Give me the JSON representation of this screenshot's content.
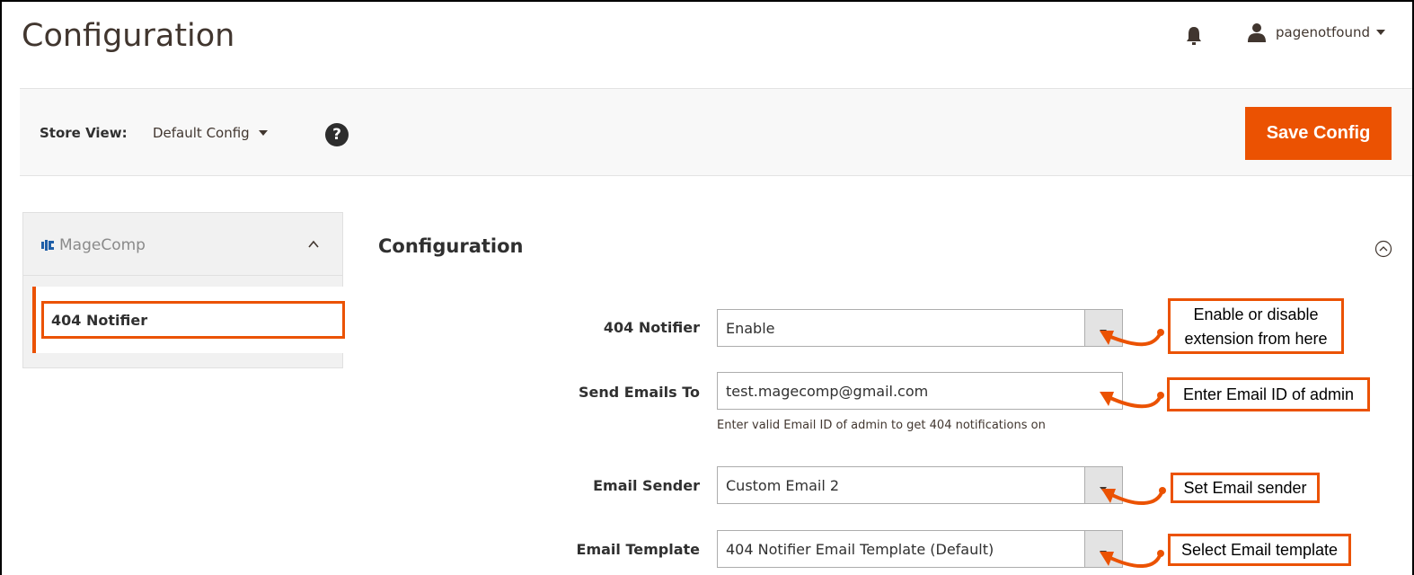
{
  "header": {
    "title": "Configuration",
    "user": "pagenotfound"
  },
  "store_bar": {
    "label": "Store View:",
    "selected": "Default Config",
    "help": "?",
    "save_label": "Save Config"
  },
  "sidebar": {
    "brand": "MageComp",
    "items": [
      {
        "label": "404 Notifier"
      }
    ]
  },
  "section": {
    "title": "Configuration",
    "fields": [
      {
        "label": "404 Notifier",
        "value": "Enable",
        "type": "select"
      },
      {
        "label": "Send Emails To",
        "value": "test.magecomp@gmail.com",
        "type": "text",
        "note": "Enter valid Email ID of admin to get 404 notifications on"
      },
      {
        "label": "Email Sender",
        "value": "Custom Email 2",
        "type": "select"
      },
      {
        "label": "Email Template",
        "value": "404 Notifier Email Template (Default)",
        "type": "select"
      }
    ]
  },
  "callouts": [
    {
      "line1": "Enable or disable",
      "line2": "extension from here"
    },
    {
      "text": "Enter Email ID of admin"
    },
    {
      "text": "Set Email sender"
    },
    {
      "text": "Select Email template"
    }
  ],
  "colors": {
    "accent": "#eb5202",
    "text": "#303030",
    "bar_bg": "#f8f8f8"
  }
}
